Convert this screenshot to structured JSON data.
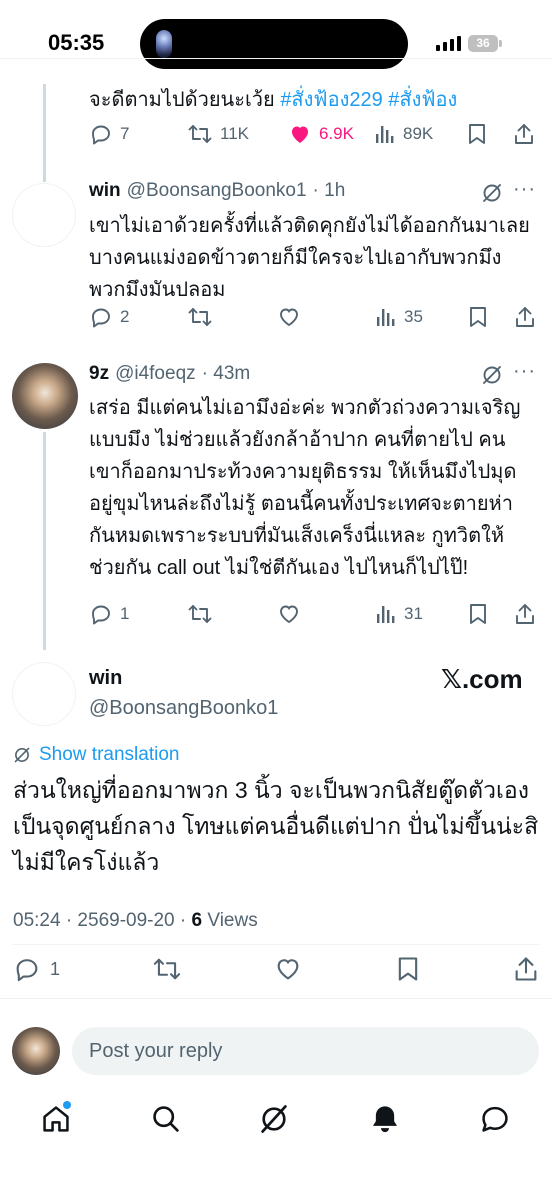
{
  "status_bar": {
    "time": "05:35",
    "battery": "36"
  },
  "top_tweet": {
    "text_plain": "จะดีตามไปด้วยนะเว้ย ",
    "hashtag1": "#สั่งฟ้อง229",
    "hashtag2": "#สั่งฟ้อง",
    "replies": "7",
    "retweets": "11K",
    "likes": "6.9K",
    "views": "89K",
    "like_color": "#f91880"
  },
  "reply1": {
    "name": "win",
    "handle": "@BoonsangBoonko1",
    "time": "· 1h",
    "text": "เขาไม่เอาด้วยครั้งที่แล้วติดคุกยังไม่ได้ออกกันมาเลยบางคนแม่งอดข้าวตายก็มีใครจะไปเอากับพวกมึง พวกมึงมันปลอม",
    "replies": "2",
    "views": "35"
  },
  "reply2": {
    "name": "9z",
    "handle": "@i4foeqz",
    "time": "· 43m",
    "text": "เสร่อ มีแต่คนไม่เอามึงอ่ะค่ะ พวกตัวถ่วงความเจริญแบบมึง ไม่ช่วยแล้วยังกล้าอ้าปาก คนที่ตายไป คนเขาก็ออกมาประท้วงความยุติธรรม ให้เห็นมึงไปมุดอยู่ขุมไหนล่ะถึงไม่รู้ ตอนนี้คนทั้งประเทศจะตายห่ากันหมดเพราะระบบที่มันเส็งเคร็งนี่แหละ กูทวิตให้ช่วยกัน call out ไม่ใช่ตีกันเอง ไปไหนก็ไปไป๊!",
    "replies": "1",
    "views": "31"
  },
  "main_tweet": {
    "name": "win",
    "handle": "@BoonsangBoonko1",
    "brand": "𝕏.com",
    "show_translation": "Show translation",
    "text": "ส่วนใหญ่ที่ออกมาพวก 3 นิ้ว จะเป็นพวกนิสัยตู๊ดตัวเองเป็นจุดศูนย์กลาง โทษแต่คนอื่นดีแต่ปาก ปั่นไม่ขึ้นน่ะสิไม่มีใครโง่แล้ว",
    "timestamp": "05:24 · 2569-09-20 · ",
    "views_count": "6",
    "views_label": " Views",
    "replies": "1"
  },
  "reply_bar": {
    "placeholder": "Post your reply"
  },
  "colors": {
    "accent": "#1d9bf0",
    "muted": "#536471",
    "text": "#0f1419"
  },
  "icons": [
    "reply-icon",
    "retweet-icon",
    "like-icon",
    "views-icon",
    "bookmark-icon",
    "share-icon",
    "grok-icon",
    "more-icon",
    "translate-icon",
    "home-icon",
    "search-icon",
    "notifications-icon",
    "messages-icon"
  ]
}
